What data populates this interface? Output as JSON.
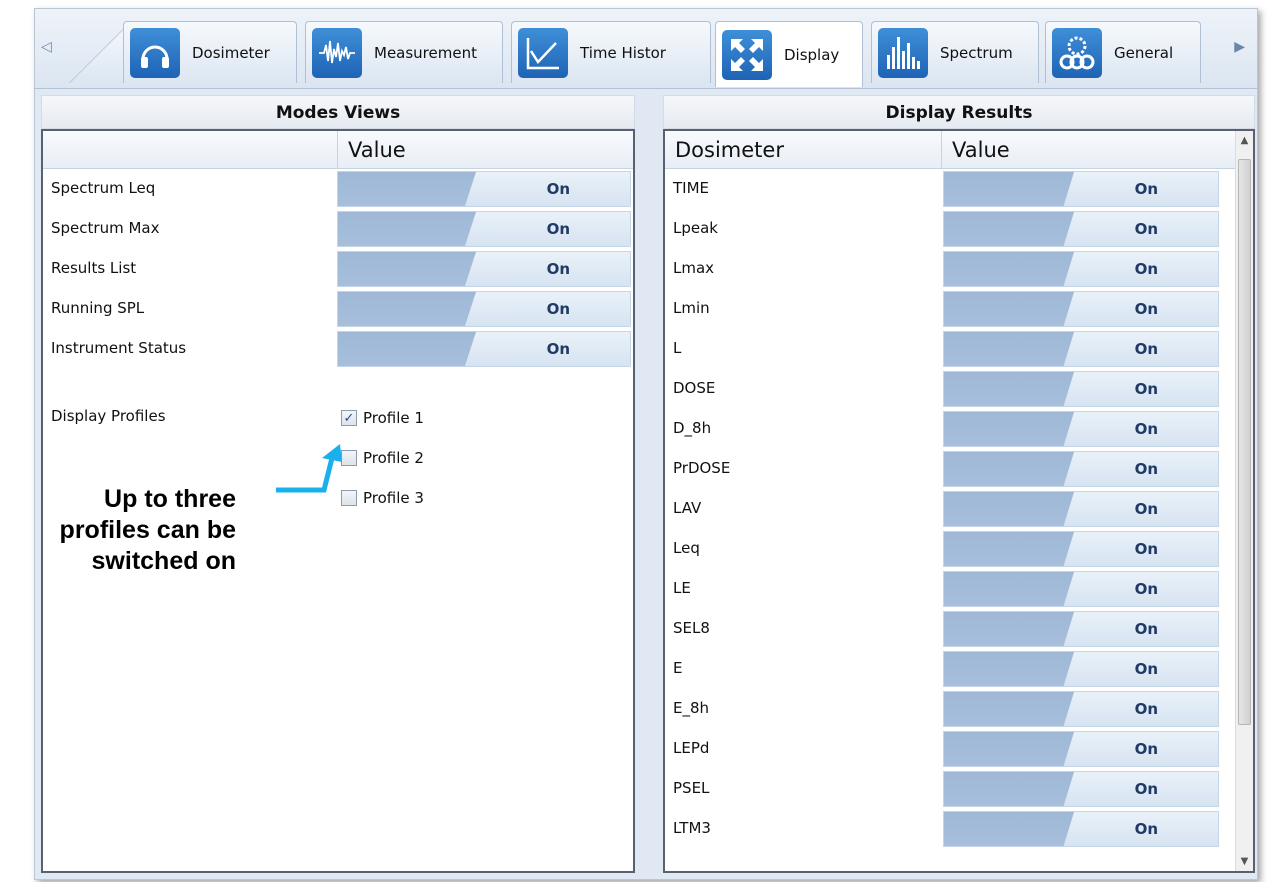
{
  "tabs": [
    {
      "label": "Dosimeter",
      "icon": "headphones-icon"
    },
    {
      "label": "Measurement",
      "icon": "waveform-icon"
    },
    {
      "label": "Time Histor",
      "icon": "line-chart-icon"
    },
    {
      "label": "Display",
      "icon": "expand-arrows-icon"
    },
    {
      "label": "Spectrum",
      "icon": "bar-spectrum-icon"
    },
    {
      "label": "General",
      "icon": "gears-icon"
    }
  ],
  "active_tab": "Display",
  "left": {
    "title": "Modes  Views",
    "value_header": "Value",
    "rows": [
      {
        "name": "Spectrum Leq",
        "value": "On"
      },
      {
        "name": "Spectrum Max",
        "value": "On"
      },
      {
        "name": "Results List",
        "value": "On"
      },
      {
        "name": "Running SPL",
        "value": "On"
      },
      {
        "name": "Instrument Status",
        "value": "On"
      }
    ],
    "profiles_label": "Display Profiles",
    "profiles": [
      {
        "label": "Profile 1",
        "checked": true
      },
      {
        "label": "Profile 2",
        "checked": false
      },
      {
        "label": "Profile 3",
        "checked": false
      }
    ]
  },
  "right": {
    "title": "Display Results",
    "name_header": "Dosimeter",
    "value_header": "Value",
    "rows": [
      {
        "name": "TIME",
        "value": "On"
      },
      {
        "name": "Lpeak",
        "value": "On"
      },
      {
        "name": "Lmax",
        "value": "On"
      },
      {
        "name": "Lmin",
        "value": "On"
      },
      {
        "name": "L",
        "value": "On"
      },
      {
        "name": "DOSE",
        "value": "On"
      },
      {
        "name": "D_8h",
        "value": "On"
      },
      {
        "name": "PrDOSE",
        "value": "On"
      },
      {
        "name": "LAV",
        "value": "On"
      },
      {
        "name": "Leq",
        "value": "On"
      },
      {
        "name": "LE",
        "value": "On"
      },
      {
        "name": "SEL8",
        "value": "On"
      },
      {
        "name": "E",
        "value": "On"
      },
      {
        "name": "E_8h",
        "value": "On"
      },
      {
        "name": "LEPd",
        "value": "On"
      },
      {
        "name": "PSEL",
        "value": "On"
      },
      {
        "name": "LTM3",
        "value": "On"
      }
    ]
  },
  "annotation": {
    "line1": "Up to three",
    "line2": "profiles can be",
    "line3": "switched on",
    "arrow_color": "#1ab0ec"
  },
  "colors": {
    "frame_bg": "#dfe8f3",
    "value_fill": "#a3bcd9",
    "value_text": "#1f3a66"
  }
}
